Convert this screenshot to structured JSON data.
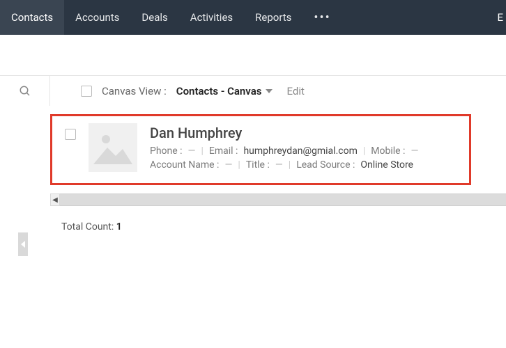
{
  "nav": {
    "items": [
      "Contacts",
      "Accounts",
      "Deals",
      "Activities",
      "Reports"
    ],
    "active_index": 0,
    "overflow_glyph": "•••",
    "right_edge": "E"
  },
  "toolbar": {
    "canvas_view_label": "Canvas View :",
    "canvas_view_value": "Contacts - Canvas",
    "edit_label": "Edit"
  },
  "record": {
    "name": "Dan Humphrey",
    "fields": {
      "phone": {
        "label": "Phone :",
        "value": "—",
        "empty": true
      },
      "email": {
        "label": "Email :",
        "value": "humphreydan@gmial.com",
        "empty": false
      },
      "mobile": {
        "label": "Mobile :",
        "value": "—",
        "empty": true
      },
      "account_name": {
        "label": "Account Name :",
        "value": "—",
        "empty": true
      },
      "title": {
        "label": "Title :",
        "value": "—",
        "empty": true
      },
      "lead_source": {
        "label": "Lead Source :",
        "value": "Online Store",
        "empty": false
      }
    }
  },
  "footer": {
    "total_count_label": "Total Count:",
    "total_count_value": "1"
  },
  "hscroll": {
    "left_glyph": "◀"
  }
}
